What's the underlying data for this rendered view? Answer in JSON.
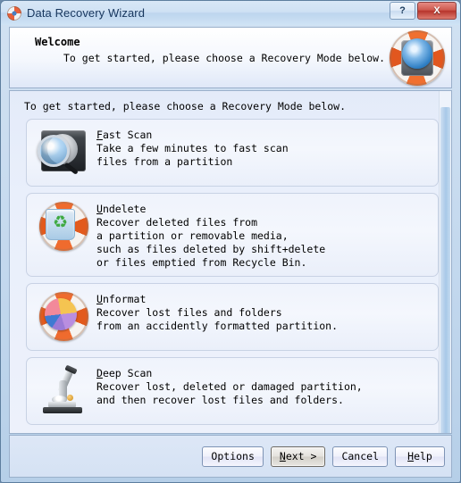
{
  "window": {
    "title": "Data Recovery Wizard",
    "app_icon": "life-ring-icon",
    "help_button": "?",
    "close_button": "X"
  },
  "header": {
    "title": "Welcome",
    "subtitle": "To get started, please choose a Recovery Mode below.",
    "icon": "life-ring-hard-drive-icon"
  },
  "main": {
    "intro": "To get started, please choose a Recovery Mode below.",
    "modes": [
      {
        "id": "fast-scan",
        "accel": "F",
        "title_rest": "ast Scan",
        "title_full": "Fast Scan",
        "icon": "hard-disk-magnifier-icon",
        "lines": [
          "Take a few minutes to fast scan",
          "files from a partition"
        ]
      },
      {
        "id": "undelete",
        "accel": "U",
        "title_rest": "ndelete",
        "title_full": "Undelete",
        "icon": "life-ring-recycle-bin-icon",
        "lines": [
          "Recover deleted files from",
          "a partition or removable media,",
          "such as files deleted by shift+delete",
          "or files emptied from Recycle Bin."
        ]
      },
      {
        "id": "unformat",
        "accel": "U",
        "title_rest": "nformat",
        "title_full": "Unformat",
        "icon": "life-ring-pie-chart-icon",
        "lines": [
          "Recover lost files and folders",
          "from an accidently formatted partition."
        ]
      },
      {
        "id": "deep-scan",
        "accel": "D",
        "title_rest": "eep Scan",
        "title_full": "Deep Scan",
        "icon": "microscope-icon",
        "lines": [
          "Recover lost, deleted or damaged partition,",
          "and then recover lost files and folders."
        ]
      }
    ]
  },
  "footer": {
    "buttons": [
      {
        "id": "options",
        "accel": "",
        "rest": "Options",
        "label": "Options",
        "default": false
      },
      {
        "id": "next",
        "accel": "N",
        "rest": "ext >",
        "label": "Next >",
        "default": true
      },
      {
        "id": "cancel",
        "accel": "",
        "rest": "Cancel",
        "label": "Cancel",
        "default": false
      },
      {
        "id": "help",
        "accel": "H",
        "rest": "elp",
        "label": "Help",
        "default": false
      }
    ]
  },
  "colors": {
    "window_frame": "#5d7e9e",
    "title_text": "#17365d",
    "close_button": "#b7352c",
    "content_bg": "#e9effb",
    "card_border": "#c8d2e4"
  }
}
